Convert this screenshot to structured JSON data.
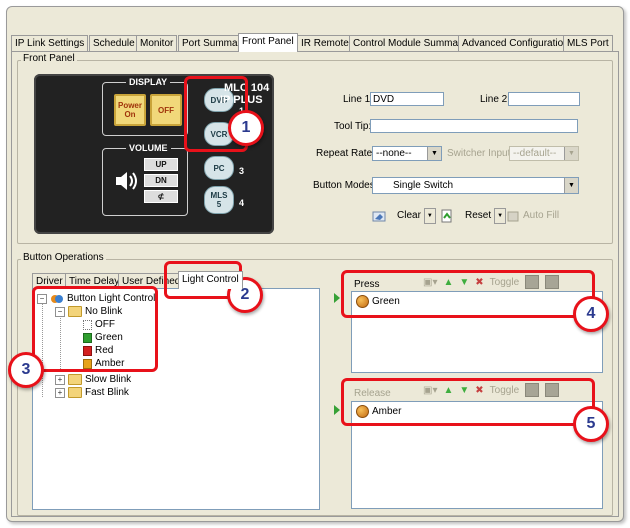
{
  "tabs": [
    "IP Link Settings",
    "Schedule",
    "Monitor",
    "Port Summary",
    "Front Panel",
    "IR Remote",
    "Control Module Summary",
    "Advanced Configuration",
    "MLS Port"
  ],
  "active_tab_index": 4,
  "front_panel": {
    "group_title": "Front Panel",
    "device": {
      "display_label": "DISPLAY",
      "power_on": "Power\nOn",
      "off": "OFF",
      "volume_label": "VOLUME",
      "up": "UP",
      "dn": "DN",
      "model": "MLC 104",
      "model_sub": "IP PLUS",
      "source_buttons": [
        "DVD",
        "VCR",
        "PC",
        "MLS\n5"
      ],
      "numbers": [
        "1",
        "2",
        "3",
        "4"
      ]
    },
    "line1_label": "Line 1:",
    "line1_value": "DVD",
    "line2_label": "Line 2:",
    "line2_value": "",
    "tooltip_label": "Tool Tip:",
    "tooltip_value": "",
    "repeat_rate_label": "Repeat Rate:",
    "repeat_rate_value": "--none--",
    "switcher_input_label": "Switcher Input:",
    "switcher_input_value": "--default--",
    "button_modes_label": "Button Modes:",
    "button_modes_value": "Single Switch",
    "clear_label": "Clear",
    "reset_label": "Reset",
    "autofill_label": "Auto Fill"
  },
  "button_operations": {
    "group_title": "Button Operations",
    "tabs": [
      "Driver",
      "Time Delay",
      "User Defined",
      "Light Control"
    ],
    "active_tab_index": 3,
    "tree": {
      "root": "Button Light Control",
      "no_blink": "No Blink",
      "no_blink_items": [
        "OFF",
        "Green",
        "Red",
        "Amber"
      ],
      "slow_blink": "Slow Blink",
      "fast_blink": "Fast Blink"
    },
    "press": {
      "label": "Press",
      "toggle_label": "Toggle",
      "entry": "Green"
    },
    "release": {
      "label": "Release",
      "toggle_label": "Toggle",
      "entry": "Amber"
    }
  },
  "callouts": [
    "1",
    "2",
    "3",
    "4",
    "5"
  ],
  "colors": {
    "annotation_red": "#e8111a",
    "callout_number": "#2b3a8f",
    "green": "#2f9e2f",
    "red": "#d42020",
    "amber": "#e6a21a"
  }
}
